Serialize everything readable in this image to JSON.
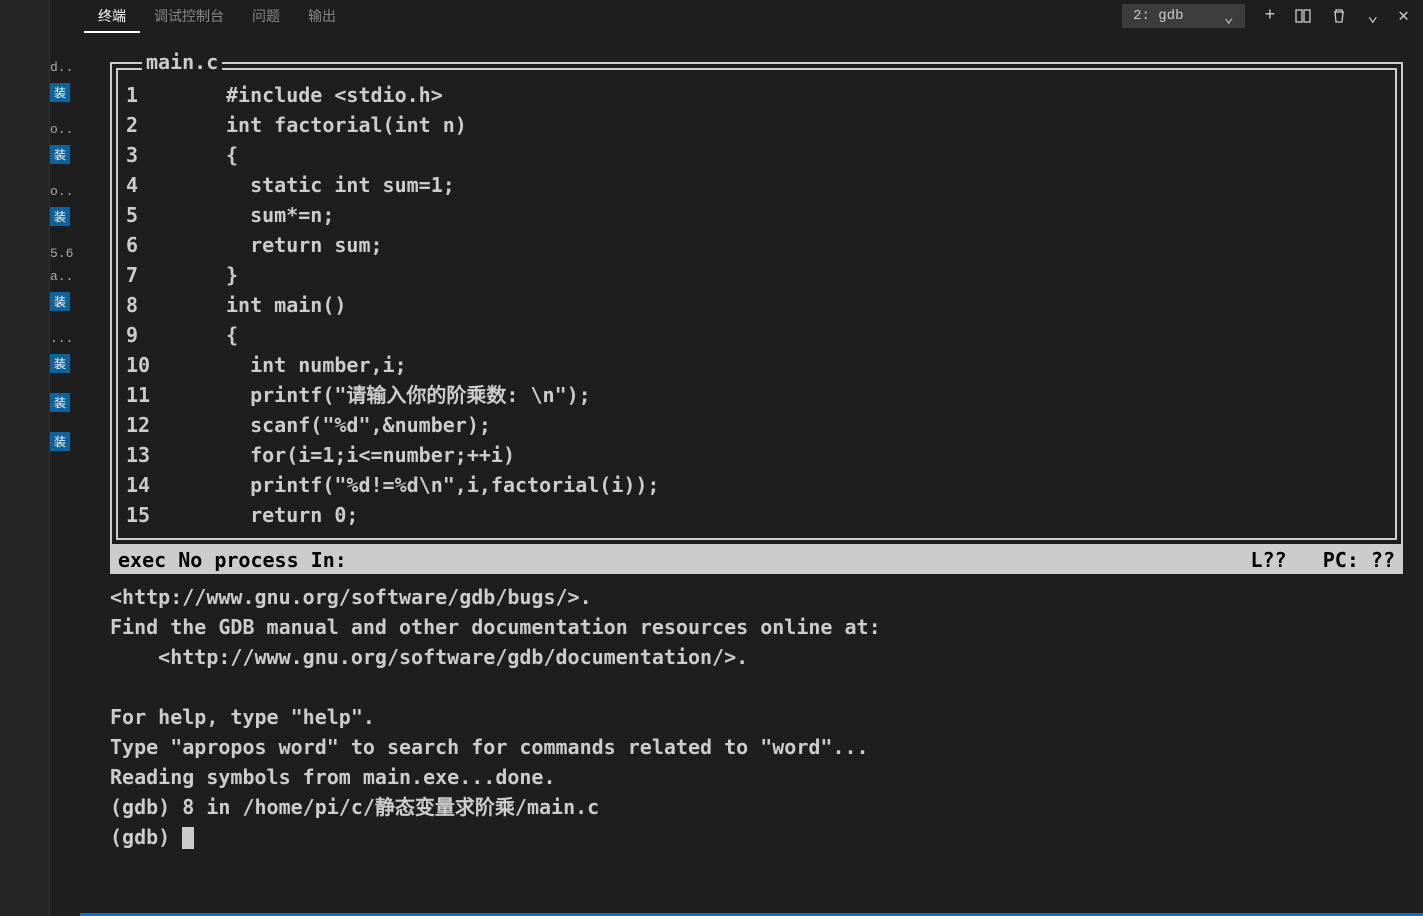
{
  "tabs": {
    "terminal": "终端",
    "debug_console": "调试控制台",
    "problems": "问题",
    "output": "输出"
  },
  "terminal_selector": "2: gdb",
  "sidebar_items": [
    {
      "label": "d..",
      "badge": "装"
    },
    {
      "label": "o..",
      "badge": "装"
    },
    {
      "label": "o..",
      "badge": "装"
    },
    {
      "label": "5.6",
      "badge": ""
    },
    {
      "label": "a..",
      "badge": "装"
    },
    {
      "label": "...",
      "badge": "装"
    },
    {
      "label": "",
      "badge": "装"
    },
    {
      "label": "",
      "badge": "装"
    }
  ],
  "code": {
    "filename": "main.c",
    "lines": [
      {
        "n": "1",
        "t": "#include <stdio.h>"
      },
      {
        "n": "2",
        "t": "int factorial(int n)"
      },
      {
        "n": "3",
        "t": "{"
      },
      {
        "n": "4",
        "t": "  static int sum=1;"
      },
      {
        "n": "5",
        "t": "  sum*=n;"
      },
      {
        "n": "6",
        "t": "  return sum;"
      },
      {
        "n": "7",
        "t": "}"
      },
      {
        "n": "8",
        "t": "int main()"
      },
      {
        "n": "9",
        "t": "{"
      },
      {
        "n": "10",
        "t": "  int number,i;"
      },
      {
        "n": "11",
        "t": "  printf(\"请输入你的阶乘数: \\n\");"
      },
      {
        "n": "12",
        "t": "  scanf(\"%d\",&number);"
      },
      {
        "n": "13",
        "t": "  for(i=1;i<=number;++i)"
      },
      {
        "n": "14",
        "t": "  printf(\"%d!=%d\\n\",i,factorial(i));"
      },
      {
        "n": "15",
        "t": "  return 0;"
      }
    ]
  },
  "status": {
    "left": "exec No process In:",
    "right": "L??   PC: ??"
  },
  "gdb": [
    "<http://www.gnu.org/software/gdb/bugs/>.",
    "Find the GDB manual and other documentation resources online at:",
    "    <http://www.gnu.org/software/gdb/documentation/>.",
    "",
    "For help, type \"help\".",
    "Type \"apropos word\" to search for commands related to \"word\"...",
    "Reading symbols from main.exe...done.",
    "(gdb) 8 in /home/pi/c/静态变量求阶乘/main.c"
  ],
  "prompt": "(gdb) "
}
